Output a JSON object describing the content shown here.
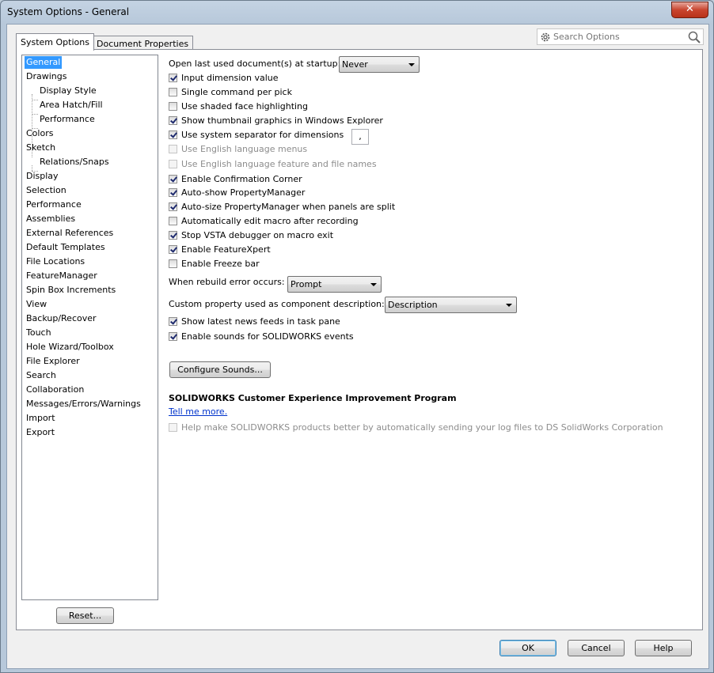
{
  "window": {
    "title": "System Options - General",
    "close_label": "✕"
  },
  "tabs": [
    {
      "label": "System Options",
      "active": true
    },
    {
      "label": "Document Properties",
      "active": false
    }
  ],
  "search": {
    "placeholder": "Search Options"
  },
  "tree": [
    {
      "label": "General",
      "selected": true
    },
    {
      "label": "Drawings"
    },
    {
      "label": "Display Style",
      "child": true
    },
    {
      "label": "Area Hatch/Fill",
      "child": true
    },
    {
      "label": "Performance",
      "child": true
    },
    {
      "label": "Colors"
    },
    {
      "label": "Sketch"
    },
    {
      "label": "Relations/Snaps",
      "child": true
    },
    {
      "label": "Display"
    },
    {
      "label": "Selection"
    },
    {
      "label": "Performance"
    },
    {
      "label": "Assemblies"
    },
    {
      "label": "External References"
    },
    {
      "label": "Default Templates"
    },
    {
      "label": "File Locations"
    },
    {
      "label": "FeatureManager"
    },
    {
      "label": "Spin Box Increments"
    },
    {
      "label": "View"
    },
    {
      "label": "Backup/Recover"
    },
    {
      "label": "Touch"
    },
    {
      "label": "Hole Wizard/Toolbox"
    },
    {
      "label": "File Explorer"
    },
    {
      "label": "Search"
    },
    {
      "label": "Collaboration"
    },
    {
      "label": "Messages/Errors/Warnings"
    },
    {
      "label": "Import"
    },
    {
      "label": "Export"
    }
  ],
  "general": {
    "open_last_label": "Open last used document(s) at startup:",
    "open_last_value": "Never",
    "checkboxes_a": [
      {
        "label": "Input dimension value",
        "checked": true
      },
      {
        "label": "Single command per pick",
        "checked": false
      },
      {
        "label": "Use shaded face highlighting",
        "checked": false
      },
      {
        "label": "Show thumbnail graphics in Windows Explorer",
        "checked": true
      },
      {
        "label": "Use system separator for dimensions",
        "checked": true
      },
      {
        "label": "Use English language menus",
        "checked": false,
        "disabled": true
      },
      {
        "label": "Use English language feature and file names",
        "checked": false,
        "disabled": true
      },
      {
        "label": "Enable Confirmation Corner",
        "checked": true
      },
      {
        "label": "Auto-show PropertyManager",
        "checked": true
      },
      {
        "label": "Auto-size PropertyManager when panels are split",
        "checked": true
      },
      {
        "label": "Automatically edit macro after recording",
        "checked": false
      },
      {
        "label": "Stop VSTA debugger on macro exit",
        "checked": true
      },
      {
        "label": "Enable FeatureXpert",
        "checked": true
      },
      {
        "label": "Enable Freeze bar",
        "checked": false
      }
    ],
    "separator_value": ",",
    "rebuild_label": "When rebuild error occurs:",
    "rebuild_value": "Prompt",
    "custom_prop_label": "Custom property used as component description:",
    "custom_prop_value": "Description",
    "checkboxes_b": [
      {
        "label": "Show latest news feeds in task pane",
        "checked": true
      },
      {
        "label": "Enable sounds for SOLIDWORKS events",
        "checked": true
      }
    ],
    "configure_sounds_label": "Configure Sounds...",
    "ceip_heading": "SOLIDWORKS Customer Experience Improvement Program",
    "tell_me_more": "Tell me more.",
    "ceip_checkbox": {
      "label": "Help make SOLIDWORKS products better by automatically sending your log files to DS SolidWorks Corporation",
      "checked": false,
      "disabled": true
    }
  },
  "buttons": {
    "reset": "Reset...",
    "ok": "OK",
    "cancel": "Cancel",
    "help": "Help"
  },
  "colors": {
    "selection": "#3399ff",
    "link": "#0033cc"
  }
}
